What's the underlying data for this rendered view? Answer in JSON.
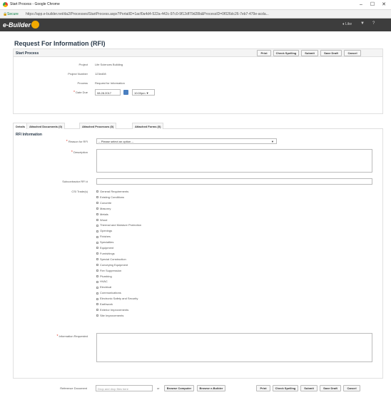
{
  "browser": {
    "title": "Start Process - Google Chrome",
    "secure_label": "Secure",
    "url": "https://app.e-builder.net/da2/Processes/StartProcess.aspx?PortalID=1acf0a4d4-522a-442c-97c0-9f12df79d28b&ProcessID=0f026dc26-7eb7-479e-acda...",
    "minimize": "–",
    "maximize": "☐",
    "close": "✕"
  },
  "app": {
    "logo_text": "e-Builder",
    "like_label": "♦ Like",
    "filter_icon": "▼",
    "help_icon": "?"
  },
  "page": {
    "title": "Request For Information (RFI)",
    "section_title": "Start Process",
    "buttons": {
      "print": "Print",
      "check_spelling": "Check Spelling",
      "submit": "Submit",
      "save_draft": "Save Draft",
      "cancel": "Cancel"
    },
    "fields": {
      "project_label": "Project",
      "project_value": "Life Sciences Building",
      "project_number_label": "Project Number",
      "project_number_value": "123ed08",
      "process_label": "Process",
      "process_value": "Request for Information",
      "date_due_label": "Date Due",
      "date_due_value": "08.28.2017",
      "time_value": "10:00pm ▼"
    },
    "tabs": [
      "Details",
      "Attached Documents (0)",
      "Attached Processes (0)",
      "Attached Forms (0)"
    ],
    "rfi_title": "RFI Information",
    "reason_label": "Reason for RFI",
    "reason_value": "-- Please select an option --",
    "description_label": "Description",
    "subcontractor_label": "Subcontractor RFI #",
    "csi_label": "CSI Trade(s)",
    "csi_trades": [
      "General Requirements",
      "Existing Conditions",
      "Concrete",
      "Masonry",
      "Metals",
      "Wood",
      "Thermal and Moisture Protection",
      "Openings",
      "Finishes",
      "Specialties",
      "Equipment",
      "Furnishings",
      "Special Construction",
      "Conveying Equipment",
      "Fire Suppression",
      "Plumbing",
      "HVAC",
      "Electrical",
      "Communications",
      "Electronic Safety and Security",
      "Earthwork",
      "Exterior Improvements",
      "Site Improvements"
    ],
    "info_requested_label": "Information Requested",
    "reference_label": "Reference Document",
    "drop_placeholder": "Drop and drop files here",
    "or_text": "or",
    "browse_computer": "Browse Computer",
    "browse_ebuilder": "Browse e-Builder"
  }
}
